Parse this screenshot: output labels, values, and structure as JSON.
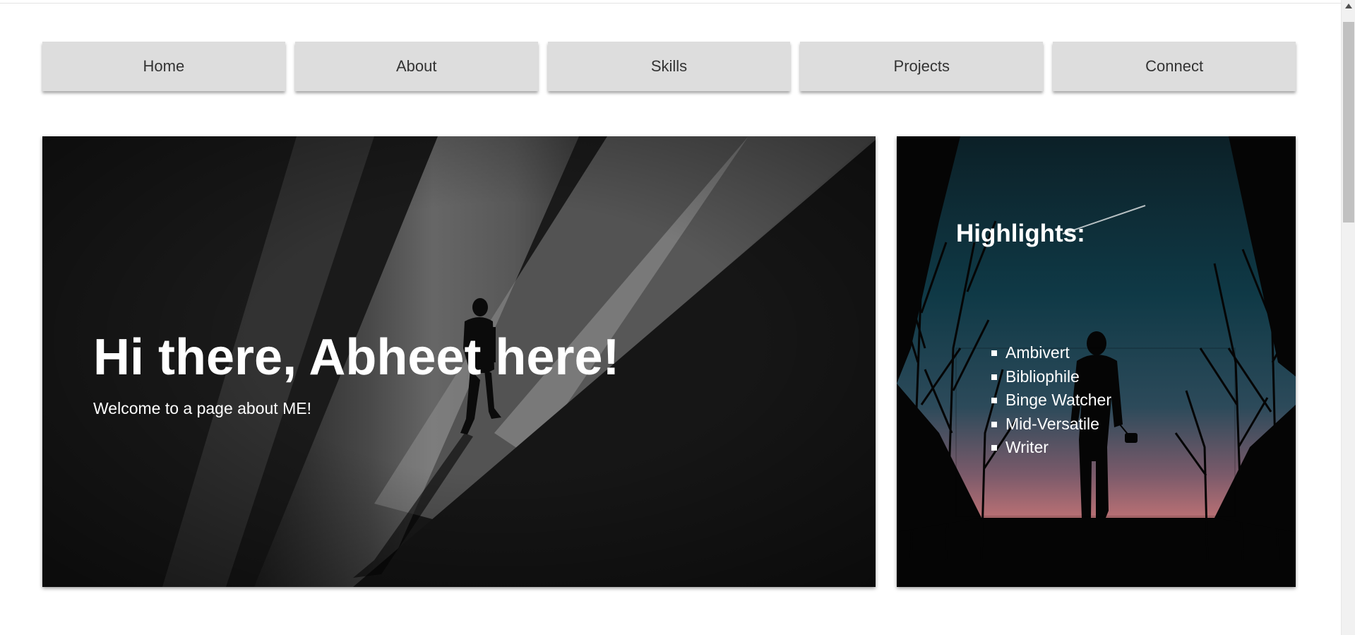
{
  "nav": {
    "items": [
      "Home",
      "About",
      "Skills",
      "Projects",
      "Connect"
    ]
  },
  "hero": {
    "title": "Hi there, Abheet here!",
    "subtitle": "Welcome to a page about ME!"
  },
  "highlights": {
    "title": "Highlights:",
    "items": [
      "Ambivert",
      "Bibliophile",
      "Binge Watcher",
      "Mid-Versatile",
      "Writer"
    ]
  },
  "colors": {
    "nav_bg": "#dddddd",
    "nav_text": "#333333",
    "hero_text": "#ffffff",
    "page_bg": "#ffffff"
  }
}
